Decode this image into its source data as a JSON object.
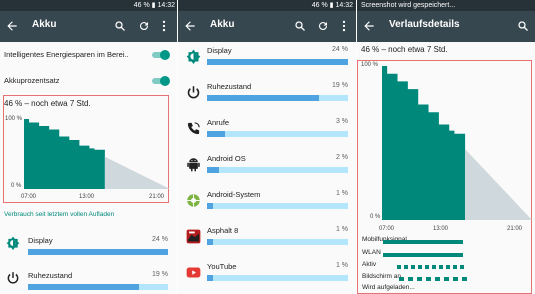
{
  "status": {
    "right_text_1": "46 % ▮ 14:32",
    "right_text_2": "46 % ▮ 14:32",
    "right_text_3": "",
    "left_text_3": "Screenshot wird gespeichert..."
  },
  "screen1": {
    "title": "Akku",
    "settings": [
      {
        "label": "Intelligentes Energiesparen im Berei..",
        "on": true
      },
      {
        "label": "Akkuprozentsatz",
        "on": true
      }
    ],
    "summary": "46 % – noch etwa 7 Std.",
    "graph": {
      "y_top": "100 %",
      "y_bottom": "0 %",
      "x_labels": [
        "07:00",
        "13:00",
        "21:00"
      ]
    },
    "usage_link": "Verbrauch seit letztem vollen Aufladen",
    "apps": [
      {
        "name": "Display",
        "percent": "24 %",
        "value": 24,
        "icon": "display-brightness-icon"
      },
      {
        "name": "Ruhezustand",
        "percent": "19 %",
        "value": 19,
        "icon": "power-icon"
      }
    ]
  },
  "screen2": {
    "title": "Akku",
    "apps": [
      {
        "name": "Display",
        "percent": "24 %",
        "value": 24,
        "icon": "display-brightness-icon"
      },
      {
        "name": "Ruhezustand",
        "percent": "19 %",
        "value": 19,
        "icon": "power-icon"
      },
      {
        "name": "Anrufe",
        "percent": "3 %",
        "value": 3,
        "icon": "phone-call-icon"
      },
      {
        "name": "Android OS",
        "percent": "2 %",
        "value": 2,
        "icon": "android-icon"
      },
      {
        "name": "Android-System",
        "percent": "1 %",
        "value": 1,
        "icon": "android-system-icon"
      },
      {
        "name": "Asphalt 8",
        "percent": "1 %",
        "value": 1,
        "icon": "asphalt-8-icon"
      },
      {
        "name": "YouTube",
        "percent": "1 %",
        "value": 1,
        "icon": "youtube-icon"
      }
    ]
  },
  "screen3": {
    "title": "Verlaufsdetails",
    "summary": "46 % – noch etwa 7 Std.",
    "graph": {
      "y_top": "100 %",
      "y_bottom": "0 %",
      "x_labels": [
        "07:00",
        "13:00",
        "21:00"
      ]
    },
    "details": [
      "Mobilfunksignal",
      "WLAN",
      "Aktiv",
      "Bildschirm an",
      "Wird aufgeladen..."
    ]
  },
  "chart_data": {
    "type": "area",
    "x_unit": "time of day",
    "y_unit": "percent",
    "ylim": [
      0,
      100
    ],
    "x": [
      "06:30",
      "07:00",
      "08:00",
      "09:00",
      "10:00",
      "11:00",
      "12:00",
      "13:00",
      "13:30",
      "14:32"
    ],
    "values": [
      100,
      95,
      90,
      85,
      75,
      70,
      62,
      58,
      56,
      46
    ],
    "projection": {
      "from": "14:32",
      "to": "21:00",
      "start": 46,
      "end": 0
    }
  },
  "colors": {
    "appbar": "#37474f",
    "statusbar": "#263238",
    "accent": "#009688",
    "bar": "#4fa3e0",
    "bar_bg": "#b3e5fc",
    "graph_fill": "#00897b",
    "projection": "#cfd8dc"
  }
}
